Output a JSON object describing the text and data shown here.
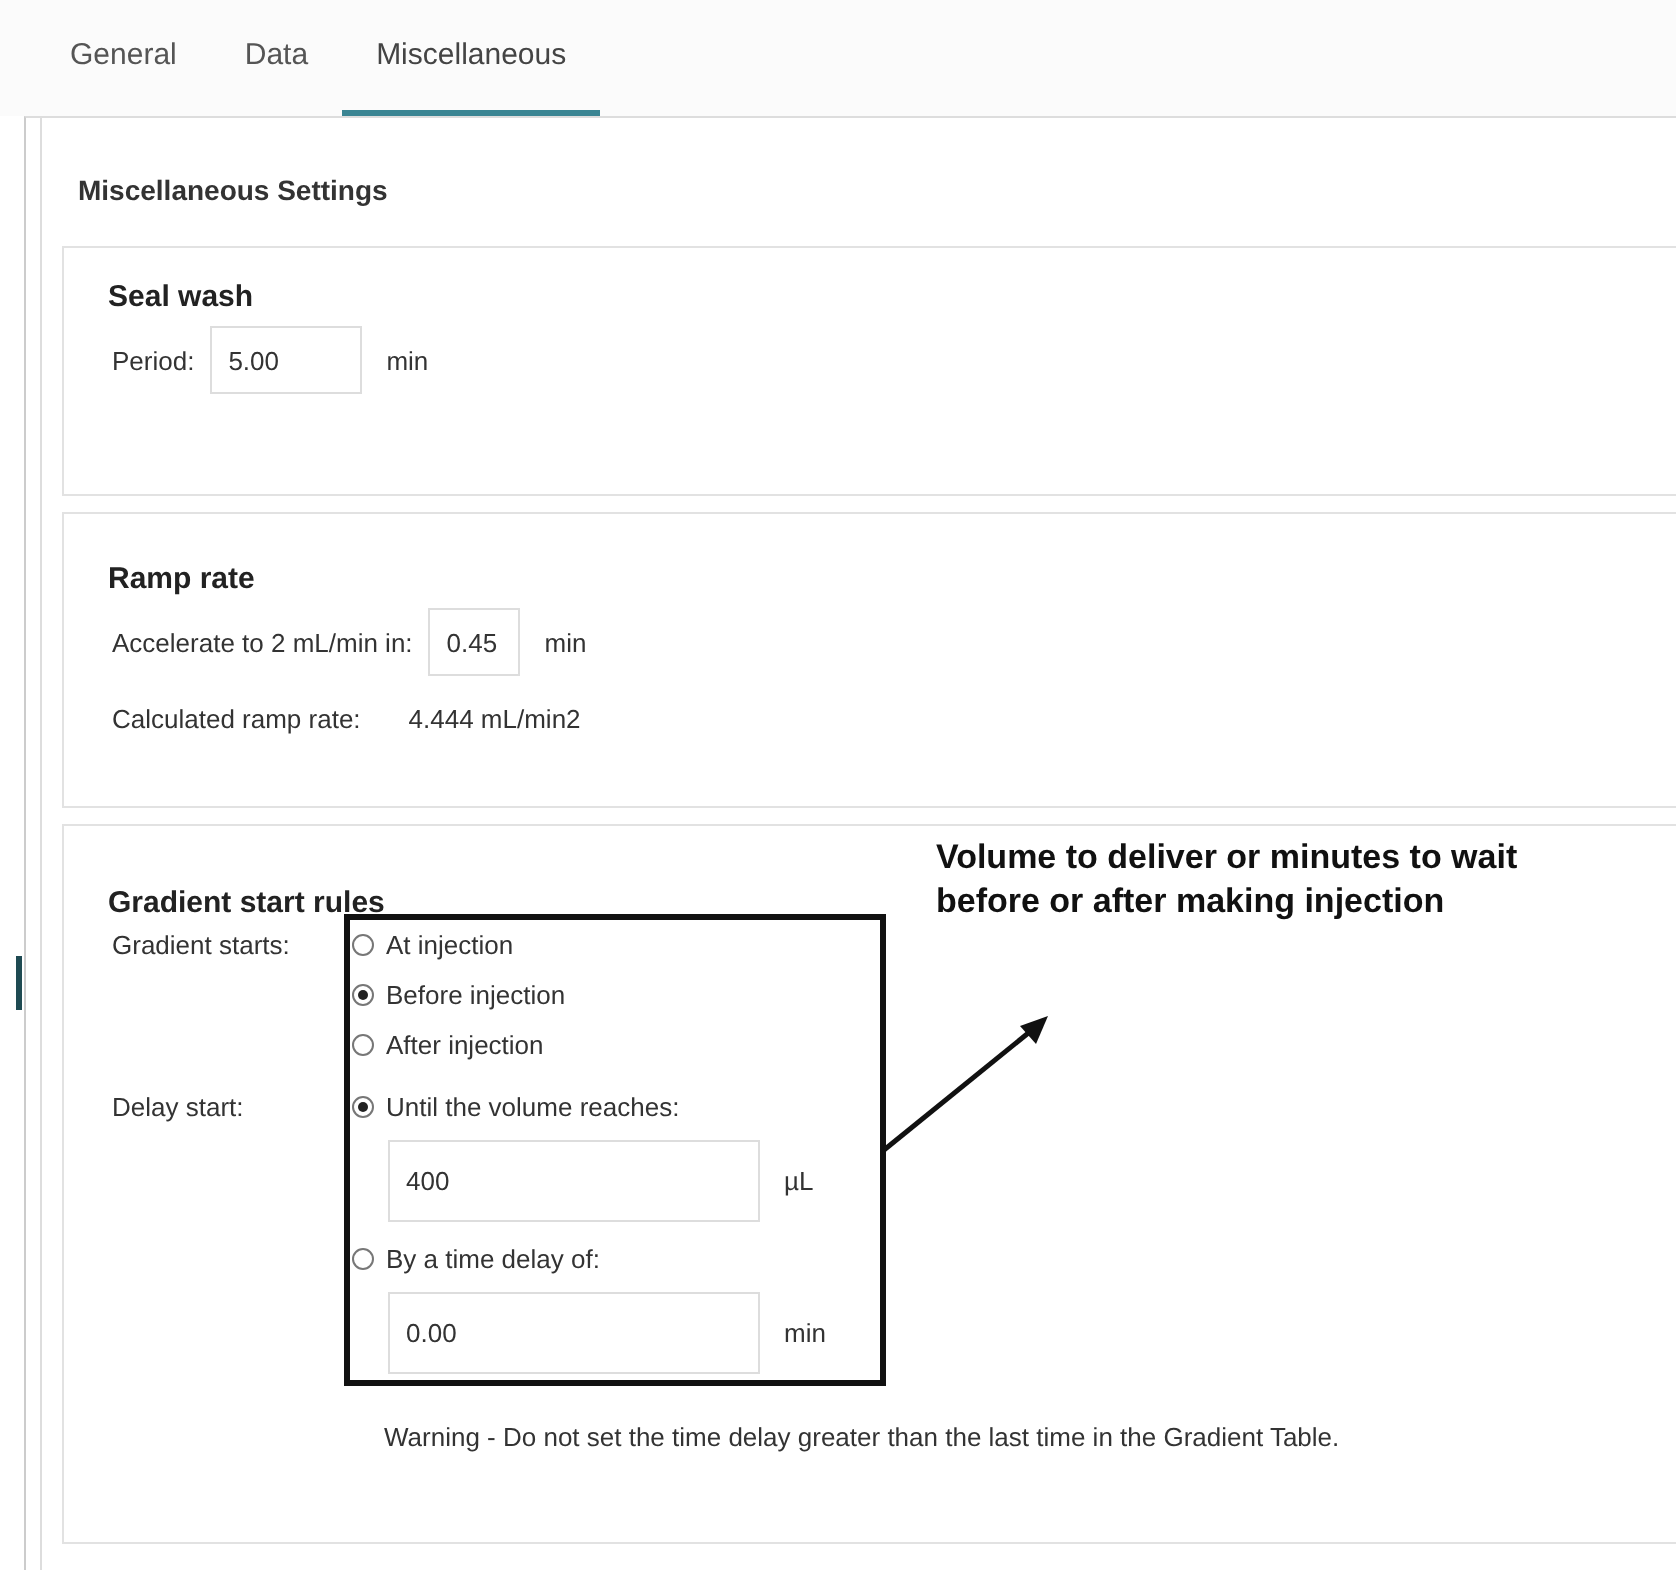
{
  "tabs": [
    {
      "label": "General",
      "selected": false
    },
    {
      "label": "Data",
      "selected": false
    },
    {
      "label": "Miscellaneous",
      "selected": true
    }
  ],
  "panel": {
    "title": "Miscellaneous Settings"
  },
  "seal_wash": {
    "title": "Seal wash",
    "period": {
      "label": "Period:",
      "value": "5.00",
      "unit": "min"
    }
  },
  "ramp_rate": {
    "title": "Ramp rate",
    "accelerate": {
      "label": "Accelerate to 2 mL/min in:",
      "value": "0.45",
      "unit": "min"
    },
    "calculated": {
      "label": "Calculated ramp rate:",
      "value": "4.444 mL/min2"
    }
  },
  "gradient_start_rules": {
    "title": "Gradient start rules",
    "starts_label": "Gradient starts:",
    "starts_options": [
      {
        "label": "At injection",
        "selected": false
      },
      {
        "label": "Before injection",
        "selected": true
      },
      {
        "label": "After injection",
        "selected": false
      }
    ],
    "delay_label": "Delay start:",
    "delay_options": [
      {
        "label": "Until the volume reaches:",
        "selected": true,
        "value": "400",
        "unit": "µL"
      },
      {
        "label": "By a time delay of:",
        "selected": false,
        "value": "0.00",
        "unit": "min"
      }
    ],
    "warning": "Warning - Do not set the time delay greater than the last time in the Gradient Table."
  },
  "annotation": {
    "lines": [
      "Volume to deliver or minutes to wait",
      "before or after making injection"
    ]
  }
}
